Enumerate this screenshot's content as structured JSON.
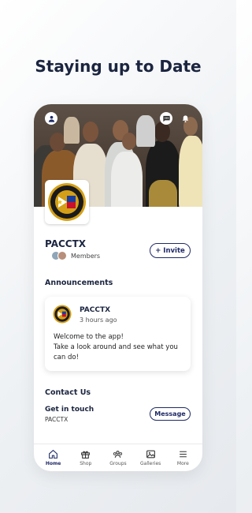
{
  "headline": "Staying up to Date",
  "group": {
    "name": "PACCTX",
    "members_label": "Members",
    "invite_label": "+ Invite"
  },
  "announcements": {
    "section_title": "Announcements",
    "post": {
      "author": "PACCTX",
      "time": "3 hours ago",
      "line1": "Welcome to the app!",
      "line2": "Take a look around and see what you can do!"
    }
  },
  "contact": {
    "section_title": "Contact Us",
    "subtitle": "Get in touch",
    "org": "PACCTX",
    "message_label": "Message"
  },
  "nav": {
    "items": [
      {
        "label": "Home",
        "icon": "home-icon",
        "active": true
      },
      {
        "label": "Shop",
        "icon": "gift-icon",
        "active": false
      },
      {
        "label": "Groups",
        "icon": "groups-icon",
        "active": false
      },
      {
        "label": "Galleries",
        "icon": "image-icon",
        "active": false
      },
      {
        "label": "More",
        "icon": "menu-icon",
        "active": false
      }
    ]
  },
  "colors": {
    "accent": "#1f2a66",
    "heading": "#1b2540"
  }
}
